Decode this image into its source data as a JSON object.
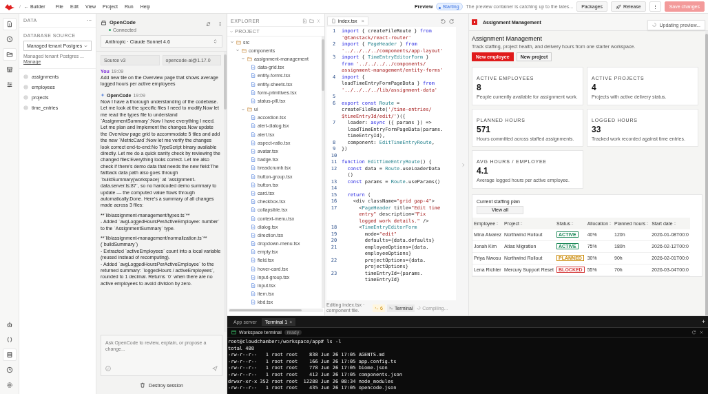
{
  "top_bar": {
    "separator": "/",
    "back_link": "← Builder",
    "menu": [
      "File",
      "Edit",
      "View",
      "Project",
      "Run",
      "Help"
    ],
    "preview_label": "Preview",
    "status_pill": "Starting",
    "status_message": "The preview container is catching up to the lates...",
    "buttons": [
      {
        "label": "Packages",
        "kind": "plain",
        "disabled": false
      },
      {
        "label": "Release",
        "kind": "rocket",
        "disabled": false
      },
      {
        "label": "⋮",
        "kind": "more",
        "disabled": false
      },
      {
        "label": "Save changes",
        "kind": "primary",
        "disabled": true
      }
    ]
  },
  "rail": {
    "top": [
      {
        "kind": "file",
        "selected": true
      },
      {
        "kind": "clock",
        "selected": false
      },
      {
        "kind": "folder",
        "selected": true
      },
      {
        "kind": "store",
        "selected": false
      },
      {
        "kind": "sliders",
        "selected": false
      }
    ],
    "bottom": [
      {
        "kind": "robot",
        "selected": false
      },
      {
        "kind": "braces",
        "selected": false
      },
      {
        "kind": "database",
        "selected": true
      },
      {
        "kind": "history",
        "selected": false
      },
      {
        "kind": "gear",
        "selected": false
      }
    ]
  },
  "data_panel": {
    "title": "DATA",
    "menu": "···",
    "source_label": "DATABASE SOURCE",
    "source_value": "Managed tenant Postgres",
    "source_note": "Managed tenant Postgres ...",
    "manage_link": "Manage",
    "tables": [
      "assignments",
      "employees",
      "projects",
      "time_entries"
    ]
  },
  "assistant": {
    "title": "OpenCode",
    "status": "Connected",
    "connected": true,
    "model": "Anthropic · Claude Sonnet 4.6",
    "tags": [
      "Source v3",
      "opencode-ai@1.17.0"
    ],
    "messages": [
      {
        "kind": "user",
        "author": "You",
        "time": "19:09",
        "paragraphs": [
          "Add new tile on the Overview page that shows average logged hours per active employees"
        ]
      },
      {
        "kind": "agent",
        "author": "OpenCode",
        "time": "19:09",
        "paragraphs": [
          "Now I have a thorough understanding of the codebase. Let me look at the specific files I need to modify.Now let me read the types file to understand `AssignmentSummary`:Now I have everything I need. Let me plan and implement the changes.Now update the Overview page grid to accommodate 5 tiles and add the new `MetricCard`:Now let me verify the changes look correct end-to-end:No TypeScript binary available directly. Let me do a quick sanity check by reviewing the changed files:Everything looks correct. Let me also check if there's demo data that needs the new field:The fallback data path also goes through `buildSummary(workspace)` at `assignment-data.server.ts:87`, so no hardcoded demo summary to update — the computed value flows through automatically.Done. Here's a summary of all changes made across 3 files:",
          "**`lib/assignment-management/types.ts`**\n- Added `avgLoggedHoursPerActiveEmployee: number` to the `AssignmentSummary` type.",
          "**`lib/assignment-management/normalization.ts`** (`buildSummary`)\n- Extracted `activeEmployees` count into a local variable (reused instead of recomputing).\n- Added `avgLoggedHoursPerActiveEmployee` to the returned summary: `loggedHours / activeEmployees`, rounded to 1 decimal. Returns `0` when there are no active employees to avoid division by zero."
        ]
      }
    ],
    "input_placeholder": "Ask OpenCode to review, explain, or propose a change...",
    "destroy": "Destroy session"
  },
  "explorer": {
    "title": "EXPLORER",
    "section": "PROJECT",
    "tree": [
      {
        "name": "src",
        "kind": "folder",
        "expanded": true,
        "children": [
          {
            "name": "components",
            "kind": "folder",
            "expanded": true,
            "children": [
              {
                "name": "assignment-management",
                "kind": "folder",
                "expanded": true,
                "children": [
                  {
                    "name": "data-grid.tsx",
                    "kind": "file"
                  },
                  {
                    "name": "entity-forms.tsx",
                    "kind": "file"
                  },
                  {
                    "name": "entity-sheets.tsx",
                    "kind": "file"
                  },
                  {
                    "name": "form-primitives.tsx",
                    "kind": "file"
                  },
                  {
                    "name": "status-pill.tsx",
                    "kind": "file"
                  }
                ]
              },
              {
                "name": "ui",
                "kind": "folder",
                "expanded": true,
                "children": [
                  {
                    "name": "accordion.tsx",
                    "kind": "file"
                  },
                  {
                    "name": "alert-dialog.tsx",
                    "kind": "file"
                  },
                  {
                    "name": "alert.tsx",
                    "kind": "file"
                  },
                  {
                    "name": "aspect-ratio.tsx",
                    "kind": "file"
                  },
                  {
                    "name": "avatar.tsx",
                    "kind": "file"
                  },
                  {
                    "name": "badge.tsx",
                    "kind": "file"
                  },
                  {
                    "name": "breadcrumb.tsx",
                    "kind": "file"
                  },
                  {
                    "name": "button-group.tsx",
                    "kind": "file"
                  },
                  {
                    "name": "button.tsx",
                    "kind": "file"
                  },
                  {
                    "name": "card.tsx",
                    "kind": "file"
                  },
                  {
                    "name": "checkbox.tsx",
                    "kind": "file"
                  },
                  {
                    "name": "collapsible.tsx",
                    "kind": "file"
                  },
                  {
                    "name": "context-menu.tsx",
                    "kind": "file"
                  },
                  {
                    "name": "dialog.tsx",
                    "kind": "file"
                  },
                  {
                    "name": "direction.tsx",
                    "kind": "file"
                  },
                  {
                    "name": "dropdown-menu.tsx",
                    "kind": "file"
                  },
                  {
                    "name": "empty.tsx",
                    "kind": "file"
                  },
                  {
                    "name": "field.tsx",
                    "kind": "file"
                  },
                  {
                    "name": "hover-card.tsx",
                    "kind": "file"
                  },
                  {
                    "name": "input-group.tsx",
                    "kind": "file"
                  },
                  {
                    "name": "input.tsx",
                    "kind": "file"
                  },
                  {
                    "name": "item.tsx",
                    "kind": "file"
                  },
                  {
                    "name": "kbd.tsx",
                    "kind": "file"
                  }
                ]
              }
            ]
          }
        ]
      }
    ]
  },
  "editor": {
    "tab": {
      "label": "index.tsx",
      "close": "×",
      "selected": true
    },
    "lines": [
      {
        "number": "1",
        "rows": [
          {
            "tokens": [
              {
                "kind": "kw",
                "text": "import"
              },
              {
                "kind": "p",
                "text": " { createFileRoute } "
              },
              {
                "kind": "kw",
                "text": "from"
              }
            ]
          },
          {
            "tokens": [
              {
                "kind": "str",
                "text": "'@tanstack/react-router'"
              }
            ]
          }
        ]
      },
      {
        "number": "2",
        "rows": [
          {
            "tokens": [
              {
                "kind": "kw",
                "text": "import"
              },
              {
                "kind": "p",
                "text": " { "
              },
              {
                "kind": "ty",
                "text": "PageHeader"
              },
              {
                "kind": "p",
                "text": " } "
              },
              {
                "kind": "kw",
                "text": "from"
              }
            ]
          },
          {
            "tokens": [
              {
                "kind": "str",
                "text": "'../../../../components/app-layout'"
              }
            ]
          }
        ]
      },
      {
        "number": "3",
        "rows": [
          {
            "tokens": [
              {
                "kind": "kw",
                "text": "import"
              },
              {
                "kind": "p",
                "text": " { "
              },
              {
                "kind": "ty",
                "text": "TimeEntryEditorForm"
              },
              {
                "kind": "p",
                "text": " }"
              }
            ]
          },
          {
            "tokens": [
              {
                "kind": "kw",
                "text": "from"
              },
              {
                "kind": "str",
                "text": " '../../../../components/"
              }
            ]
          },
          {
            "tokens": [
              {
                "kind": "str",
                "text": "assignment-management/entity-forms'"
              }
            ]
          }
        ]
      },
      {
        "number": "4",
        "rows": [
          {
            "tokens": [
              {
                "kind": "kw",
                "text": "import"
              },
              {
                "kind": "p",
                "text": " {"
              }
            ]
          },
          {
            "tokens": [
              {
                "kind": "p",
                "text": "loadTimeEntryFormPageData } "
              },
              {
                "kind": "kw",
                "text": "from"
              }
            ]
          },
          {
            "tokens": [
              {
                "kind": "str",
                "text": "'../../../../lib/assignment-data'"
              }
            ]
          }
        ]
      },
      {
        "number": "5"
      },
      {
        "number": "6",
        "rows": [
          {
            "tokens": [
              {
                "kind": "kw",
                "text": "export const "
              },
              {
                "kind": "ty",
                "text": "Route"
              },
              {
                "kind": "p",
                "text": " ="
              }
            ]
          },
          {
            "tokens": [
              {
                "kind": "p",
                "text": "createFileRoute("
              },
              {
                "kind": "str",
                "text": "'/time-entries/"
              }
            ]
          },
          {
            "tokens": [
              {
                "kind": "str",
                "text": "$timeEntryId/edit/'"
              },
              {
                "kind": "p",
                "text": ")({"
              }
            ]
          }
        ]
      },
      {
        "number": "7",
        "rows": [
          {
            "tokens": [
              {
                "kind": "p",
                "text": "  loader: "
              },
              {
                "kind": "kw",
                "text": "async"
              },
              {
                "kind": "p",
                "text": " ({ params }) =>"
              }
            ]
          },
          {
            "tokens": [
              {
                "kind": "p",
                "text": "  loadTimeEntryFormPageData(params."
              }
            ]
          },
          {
            "tokens": [
              {
                "kind": "p",
                "text": "  timeEntryId),"
              }
            ]
          }
        ]
      },
      {
        "number": "8",
        "rows": [
          {
            "tokens": [
              {
                "kind": "p",
                "text": "  component: "
              },
              {
                "kind": "ty",
                "text": "EditTimeEntryRoute"
              },
              {
                "kind": "p",
                "text": ","
              }
            ]
          }
        ]
      },
      {
        "number": "9",
        "rows": [
          {
            "tokens": [
              {
                "kind": "p",
                "text": "})"
              }
            ]
          }
        ]
      },
      {
        "number": "10"
      },
      {
        "number": "11",
        "rows": [
          {
            "tokens": [
              {
                "kind": "kw",
                "text": "function "
              },
              {
                "kind": "ty",
                "text": "EditTimeEntryRoute"
              },
              {
                "kind": "p",
                "text": "() {"
              }
            ]
          }
        ]
      },
      {
        "number": "12",
        "rows": [
          {
            "tokens": [
              {
                "kind": "kw",
                "text": "  const"
              },
              {
                "kind": "p",
                "text": " data = "
              },
              {
                "kind": "ty",
                "text": "Route"
              },
              {
                "kind": "p",
                "text": ".useLoaderData"
              }
            ]
          },
          {
            "tokens": [
              {
                "kind": "p",
                "text": "  ()"
              }
            ]
          }
        ]
      },
      {
        "number": "13",
        "rows": [
          {
            "tokens": [
              {
                "kind": "kw",
                "text": "  const"
              },
              {
                "kind": "p",
                "text": " params = "
              },
              {
                "kind": "ty",
                "text": "Route"
              },
              {
                "kind": "p",
                "text": ".useParams()"
              }
            ]
          }
        ]
      },
      {
        "number": "14"
      },
      {
        "number": "15",
        "rows": [
          {
            "tokens": [
              {
                "kind": "kw",
                "text": "  return"
              },
              {
                "kind": "p",
                "text": " ("
              }
            ]
          }
        ]
      },
      {
        "number": "16",
        "rows": [
          {
            "tokens": [
              {
                "kind": "p",
                "text": "    <div className="
              },
              {
                "kind": "str",
                "text": "\"grid gap-4\""
              },
              {
                "kind": "p",
                "text": ">"
              }
            ]
          }
        ]
      },
      {
        "number": "17",
        "rows": [
          {
            "tokens": [
              {
                "kind": "p",
                "text": "      <"
              },
              {
                "kind": "ty",
                "text": "PageHeader"
              },
              {
                "kind": "p",
                "text": " title="
              },
              {
                "kind": "str",
                "text": "\"Edit time"
              }
            ]
          },
          {
            "tokens": [
              {
                "kind": "str",
                "text": "      entry\""
              },
              {
                "kind": "p",
                "text": " description="
              },
              {
                "kind": "str",
                "text": "\"Fix"
              }
            ]
          },
          {
            "tokens": [
              {
                "kind": "str",
                "text": "      logged work details.\""
              },
              {
                "kind": "p",
                "text": " />"
              }
            ]
          }
        ]
      },
      {
        "number": "18",
        "rows": [
          {
            "tokens": [
              {
                "kind": "p",
                "text": "      <"
              },
              {
                "kind": "ty",
                "text": "TimeEntryEditorForm"
              }
            ]
          }
        ]
      },
      {
        "number": "19",
        "rows": [
          {
            "tokens": [
              {
                "kind": "p",
                "text": "        mode="
              },
              {
                "kind": "str",
                "text": "\"edit\""
              }
            ]
          }
        ]
      },
      {
        "number": "20",
        "rows": [
          {
            "tokens": [
              {
                "kind": "p",
                "text": "        defaults={data.defaults}"
              }
            ]
          }
        ]
      },
      {
        "number": "21",
        "rows": [
          {
            "tokens": [
              {
                "kind": "p",
                "text": "        employeeOptions={data."
              }
            ]
          },
          {
            "tokens": [
              {
                "kind": "p",
                "text": "        employeeOptions}"
              }
            ]
          }
        ]
      },
      {
        "number": "22",
        "rows": [
          {
            "tokens": [
              {
                "kind": "p",
                "text": "        projectOptions={data."
              }
            ]
          },
          {
            "tokens": [
              {
                "kind": "p",
                "text": "        projectOptions}"
              }
            ]
          }
        ]
      },
      {
        "number": "23",
        "rows": [
          {
            "tokens": [
              {
                "kind": "p",
                "text": "        timeEntryId={params."
              }
            ]
          },
          {
            "tokens": [
              {
                "kind": "p",
                "text": "        timeEntryId}"
              }
            ]
          }
        ]
      }
    ],
    "status": {
      "note": "Editing index.tsx · component file.",
      "problems": "6",
      "terminal": "Terminal",
      "compile": "Compiling..."
    }
  },
  "preview": {
    "app_title": "Assignment Management",
    "updating": "Updating preview...",
    "heading": "Assignment Management",
    "subtitle": "Track staffing, project health, and delivery hours from one starter workspace.",
    "actions": [
      {
        "label": "New employee",
        "kind": "primary"
      },
      {
        "label": "New project",
        "kind": "secondary"
      }
    ],
    "metrics": [
      {
        "label": "ACTIVE EMPLOYEES",
        "value": "8",
        "note": "People currently available for assignment work."
      },
      {
        "label": "ACTIVE PROJECTS",
        "value": "4",
        "note": "Projects with active delivery status."
      },
      {
        "label": "PLANNED HOURS",
        "value": "571",
        "note": "Hours committed across staffed assignments."
      },
      {
        "label": "LOGGED HOURS",
        "value": "33",
        "note": "Tracked work recorded against time entries."
      },
      {
        "label": "AVG HOURS / EMPLOYEE",
        "value": "4.1",
        "note": "Average logged hours per active employee."
      }
    ],
    "staffing": {
      "title": "Current staffing plan",
      "view_all": "View all",
      "columns": [
        "Employee",
        "Project",
        "Status",
        "Allocation",
        "Planned hours",
        "Start date"
      ],
      "rows": [
        {
          "employee": "Mina Alvarez",
          "project": "Northwind Rollout",
          "status": "ACTIVE",
          "color": "#1e8a5a",
          "allocation": "40%",
          "planned": "120h",
          "start": "2026-01-08T00:0"
        },
        {
          "employee": "Jonah Kim",
          "project": "Atlas Migration",
          "status": "ACTIVE",
          "color": "#1e8a5a",
          "allocation": "75%",
          "planned": "180h",
          "start": "2026-02-12T00:0"
        },
        {
          "employee": "Priya Nwosu",
          "project": "Northwind Rollout",
          "status": "PLANNED",
          "color": "#c98700",
          "allocation": "30%",
          "planned": "90h",
          "start": "2026-02-01T00:0"
        },
        {
          "employee": "Lena Richter",
          "project": "Mercury Support Reset",
          "status": "BLOCKED",
          "color": "#d43a3a",
          "allocation": "55%",
          "planned": "70h",
          "start": "2026-03-04T00:0"
        }
      ]
    }
  },
  "terminal": {
    "tabs": [
      {
        "label": "App server",
        "selected": false
      },
      {
        "label": "Terminal 1",
        "selected": true,
        "close": "×"
      }
    ],
    "add": "+",
    "title": "Workspace terminal",
    "state": "ready",
    "lines": [
      "root@cloudchamber:/workspace/app# ls -l",
      "total 408",
      "-rw-r--r--   1 root root    838 Jun 26 17:05 AGENTS.md",
      "-rw-r--r--   1 root root    166 Jun 26 17:05 app.config.ts",
      "-rw-r--r--   1 root root    778 Jun 26 17:05 biome.json",
      "-rw-r--r--   1 root root    412 Jun 26 17:05 components.json",
      "drwxr-xr-x 352 root root  12288 Jun 26 08:34 node_modules",
      "-rw-r--r--   1 root root    435 Jun 26 17:05 opencode.json"
    ]
  }
}
